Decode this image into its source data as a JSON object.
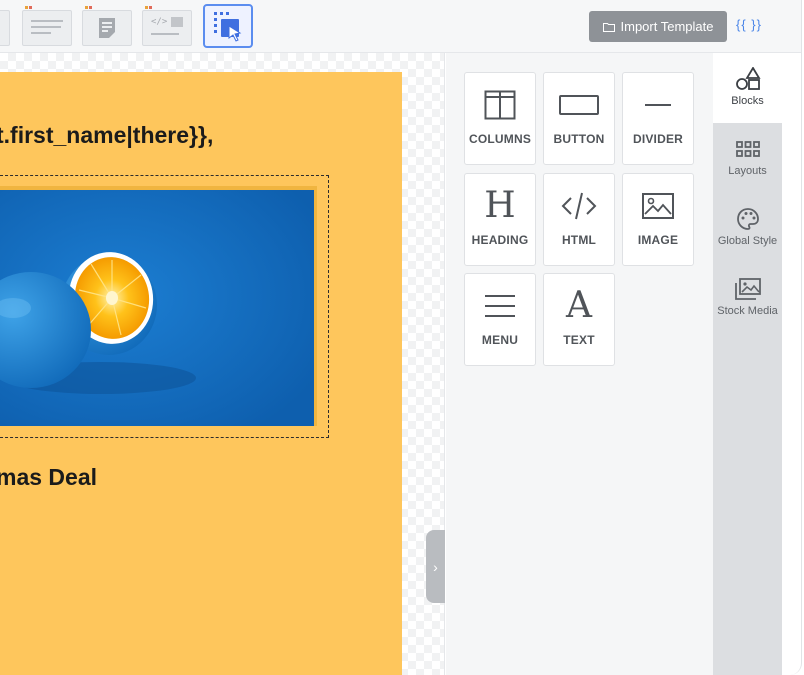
{
  "toolbar": {
    "import_label": "Import Template",
    "merge_tags_label": "{{ }}"
  },
  "email": {
    "greeting": "t.first_name|there}},",
    "deal_heading": "mas Deal"
  },
  "blocks": [
    {
      "label": "COLUMNS",
      "icon": "columns-icon"
    },
    {
      "label": "BUTTON",
      "icon": "button-icon"
    },
    {
      "label": "DIVIDER",
      "icon": "divider-icon"
    },
    {
      "label": "HEADING",
      "icon": "heading-icon"
    },
    {
      "label": "HTML",
      "icon": "code-icon"
    },
    {
      "label": "IMAGE",
      "icon": "image-icon"
    },
    {
      "label": "MENU",
      "icon": "menu-icon"
    },
    {
      "label": "TEXT",
      "icon": "text-icon"
    }
  ],
  "tabs": [
    {
      "label": "Blocks",
      "icon": "shapes-icon",
      "active": true
    },
    {
      "label": "Layouts",
      "icon": "grid-icon",
      "active": false
    },
    {
      "label": "Global Style",
      "icon": "palette-icon",
      "active": false
    },
    {
      "label": "Stock Media",
      "icon": "photos-icon",
      "active": false
    }
  ],
  "colors": {
    "email_background": "#fec65c",
    "photo_background": "#1672c4",
    "accent": "#5b8def"
  }
}
